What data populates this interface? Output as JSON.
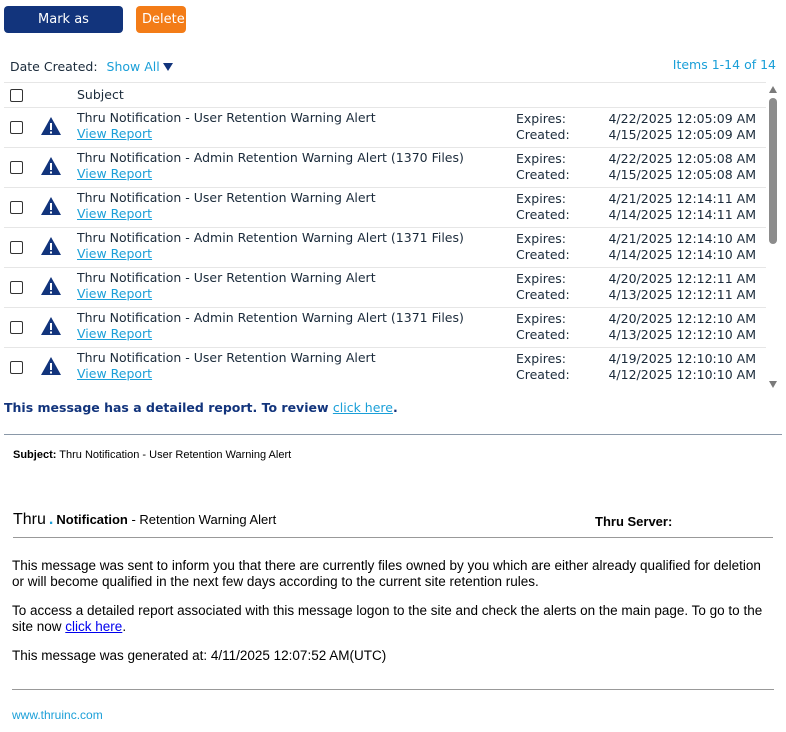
{
  "toolbar": {
    "mark_reviewed_label": "Mark as Reviewed",
    "delete_label": "Delete"
  },
  "filter": {
    "label": "Date Created:",
    "value": "Show All"
  },
  "items_count": "Items 1-14 of 14",
  "list": {
    "header_subject": "Subject",
    "expires_label": "Expires:",
    "created_label": "Created:",
    "view_report_label": "View Report",
    "rows": [
      {
        "subject": "Thru Notification - User Retention Warning Alert",
        "expires": "4/22/2025 12:05:09 AM",
        "created": "4/15/2025 12:05:09 AM"
      },
      {
        "subject": "Thru Notification - Admin Retention Warning Alert (1370 Files)",
        "expires": "4/22/2025 12:05:08 AM",
        "created": "4/15/2025 12:05:08 AM"
      },
      {
        "subject": "Thru Notification - User Retention Warning Alert",
        "expires": "4/21/2025 12:14:11 AM",
        "created": "4/14/2025 12:14:11 AM"
      },
      {
        "subject": "Thru Notification - Admin Retention Warning Alert (1371 Files)",
        "expires": "4/21/2025 12:14:10 AM",
        "created": "4/14/2025 12:14:10 AM"
      },
      {
        "subject": "Thru Notification - User Retention Warning Alert",
        "expires": "4/20/2025 12:12:11 AM",
        "created": "4/13/2025 12:12:11 AM"
      },
      {
        "subject": "Thru Notification - Admin Retention Warning Alert (1371 Files)",
        "expires": "4/20/2025 12:12:10 AM",
        "created": "4/13/2025 12:12:10 AM"
      },
      {
        "subject": "Thru Notification - User Retention Warning Alert",
        "expires": "4/19/2025 12:10:10 AM",
        "created": "4/12/2025 12:10:10 AM"
      }
    ]
  },
  "detail_note": {
    "text": "This message has a detailed report. To review ",
    "link": "click here",
    "suffix": "."
  },
  "preview": {
    "subject_label": "Subject:",
    "subject_value": " Thru Notification - User Retention Warning Alert",
    "brand": "Thru",
    "brand_dot": ".",
    "notification": "Notification",
    "notification_rest": " - Retention Warning Alert",
    "server_label": "Thru Server:",
    "para1": "This message was sent to inform you that there are currently files owned by you which are either already qualified for deletion or will become qualified in the next few days according to the current site retention rules.",
    "para2_text": "To access a detailed report associated with this message logon to the site and check the alerts on the main page. To go to the site now ",
    "para2_link": "click here",
    "para2_suffix": ".",
    "para3": "This message was generated at: 4/11/2025 12:07:52 AM(UTC)",
    "footer_link": "www.thruinc.com"
  },
  "colors": {
    "primary_navy": "#12347c",
    "delete_orange": "#f37c17",
    "link_blue": "#1a9fd8"
  }
}
